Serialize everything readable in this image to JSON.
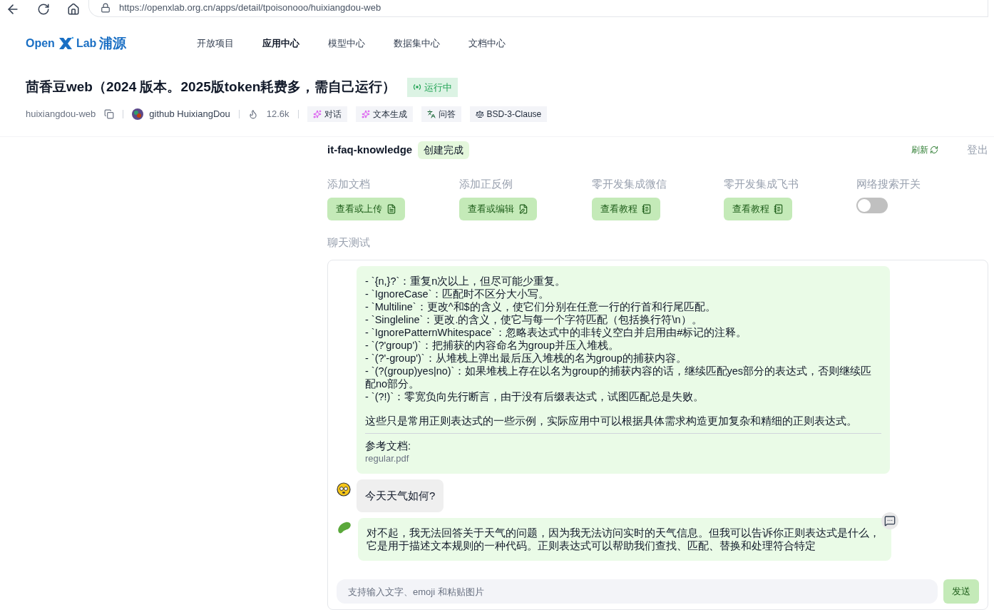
{
  "browser": {
    "url": "https://openxlab.org.cn/apps/detail/tpoisonooo/huixiangdou-web"
  },
  "logo": {
    "open": "Open",
    "lab": "Lab",
    "cn": "浦源"
  },
  "nav": [
    {
      "label": "开放项目",
      "selected": false
    },
    {
      "label": "应用中心",
      "selected": true
    },
    {
      "label": "模型中心",
      "selected": false
    },
    {
      "label": "数据集中心",
      "selected": false
    },
    {
      "label": "文档中心",
      "selected": false
    }
  ],
  "app": {
    "title": "茴香豆web（2024 版本。2025版token耗费多，需自己运行）",
    "status": "运行中",
    "repo": "huixiangdou-web",
    "author": "github HuixiangDou",
    "likes": "12.6k",
    "tags": [
      {
        "kind": "sparkle",
        "label": "对话"
      },
      {
        "kind": "sparkle",
        "label": "文本生成"
      },
      {
        "kind": "translate",
        "label": "问答"
      },
      {
        "kind": "scale",
        "label": "BSD-3-Clause"
      }
    ]
  },
  "workspace": {
    "name": "it-faq-knowledge",
    "status": "创建完成",
    "refresh": "刷新",
    "logout": "登出"
  },
  "actions": [
    {
      "kind": "upload",
      "label": "添加文档",
      "button": "查看或上传"
    },
    {
      "kind": "edit",
      "label": "添加正反例",
      "button": "查看或编辑"
    },
    {
      "kind": "tutorial",
      "label": "零开发集成微信",
      "button": "查看教程"
    },
    {
      "kind": "tutorial",
      "label": "零开发集成飞书",
      "button": "查看教程"
    },
    {
      "kind": "toggle",
      "label": "网络搜索开关",
      "on": false
    }
  ],
  "chat": {
    "title": "聊天测试",
    "placeholder": "支持输入文字、emoji 和粘贴图片",
    "send": "发送",
    "messages": [
      {
        "kind": "bot",
        "avatar": false,
        "paragraphs": [
          [
            "- `{n,}?`：重复n次以上，但尽可能少重复。",
            "- `IgnoreCase`：匹配时不区分大小写。",
            "- `Multiline`：更改^和$的含义，使它们分别在任意一行的行首和行尾匹配。",
            "- `Singleline`：更改.的含义，使它与每一个字符匹配（包括换行符\\n）。",
            "- `IgnorePatternWhitespace`：忽略表达式中的非转义空白并启用由#标记的注释。",
            "- `(?'group')`：把捕获的内容命名为group并压入堆栈。",
            "- `(?'-group')`：从堆栈上弹出最后压入堆栈的名为group的捕获内容。",
            "- `(?(group)yes|no)`：如果堆栈上存在以名为group的捕获内容的话，继续匹配yes部分的表达式，否则继续匹配no部分。",
            "- `(?!)`：零宽负向先行断言，由于没有后缀表达式，试图匹配总是失败。"
          ],
          [
            "这些只是常用正则表达式的一些示例，实际应用中可以根据具体需求构造更加复杂和精细的正则表达式。"
          ]
        ],
        "reference": {
          "label": "参考文档:",
          "file": "regular.pdf"
        }
      },
      {
        "kind": "user",
        "avatar": true,
        "text": "今天天气如何?"
      },
      {
        "kind": "bot",
        "avatar": true,
        "paragraphs": [
          [
            "对不起，我无法回答关于天气的问题，因为我无法访问实时的天气信息。但我可以告诉你正则表达式是什么，它是用于描述文本规则的一种代码。正则表达式可以帮助我们查找、匹配、替换和处理符合特定"
          ]
        ]
      }
    ]
  }
}
